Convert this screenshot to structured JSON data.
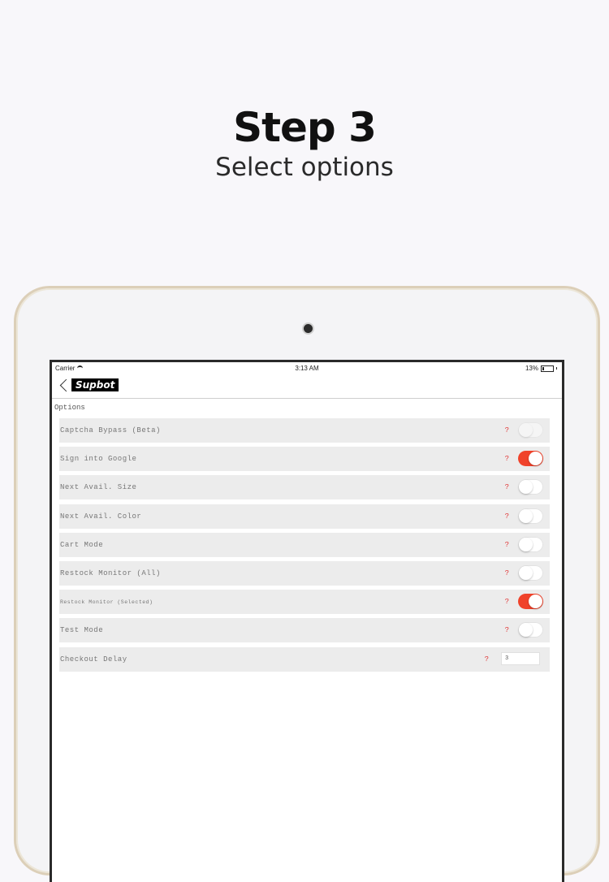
{
  "headline": {
    "title": "Step 3",
    "subtitle": "Select options"
  },
  "status": {
    "carrier": "Carrier",
    "time": "3:13 AM",
    "battery": "13%",
    "battery_level": 0.13
  },
  "nav": {
    "logo": "Supbot"
  },
  "options": {
    "title": "Options",
    "help_glyph": "?",
    "rows": [
      {
        "label": "Captcha Bypass (Beta)",
        "on": false,
        "disabled": true
      },
      {
        "label": "Sign into Google",
        "on": true
      },
      {
        "label": "Next Avail. Size",
        "on": false
      },
      {
        "label": "Next Avail. Color",
        "on": false
      },
      {
        "label": "Cart Mode",
        "on": false
      },
      {
        "label": "Restock Monitor (All)",
        "on": false
      },
      {
        "label": "Restock Monitor (Selected)",
        "on": true
      },
      {
        "label": "Test Mode",
        "on": false
      }
    ],
    "checkout_delay": {
      "label": "Checkout Delay",
      "value": "3"
    }
  },
  "colors": {
    "toggle_on": "#f0422a",
    "help": "#e03a3a"
  }
}
